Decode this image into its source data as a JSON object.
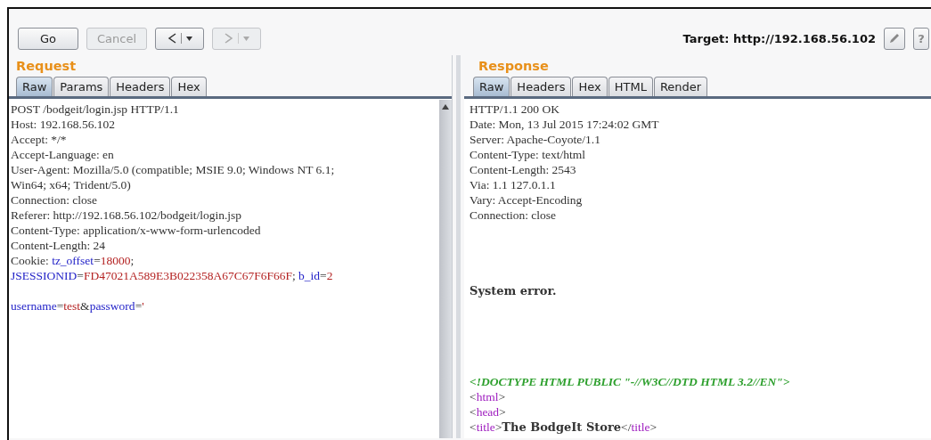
{
  "toolbar": {
    "buttons": [
      {
        "label": "Go",
        "disabled": false
      },
      {
        "label": "Cancel",
        "disabled": true
      }
    ],
    "nav": [
      {
        "kind": "back",
        "disabled": false
      },
      {
        "kind": "forward",
        "disabled": true
      }
    ],
    "target": "Target: http://192.168.56.102",
    "help": "?"
  },
  "request": {
    "title": "Request",
    "tabs": [
      {
        "label": "Raw",
        "selected": true
      },
      {
        "label": "Params",
        "selected": false
      },
      {
        "label": "Headers",
        "selected": false
      },
      {
        "label": "Hex",
        "selected": false
      }
    ],
    "lines": [
      {
        "kind": "text",
        "tokens": [
          {
            "kind": "plain",
            "text": "POST /bodgeit/login.jsp HTTP/1.1"
          }
        ]
      },
      {
        "kind": "text",
        "tokens": [
          {
            "kind": "plain",
            "text": "Host: 192.168.56.102"
          }
        ]
      },
      {
        "kind": "text",
        "tokens": [
          {
            "kind": "plain",
            "text": "Accept: */*"
          }
        ]
      },
      {
        "kind": "text",
        "tokens": [
          {
            "kind": "plain",
            "text": "Accept-Language: en"
          }
        ]
      },
      {
        "kind": "text",
        "tokens": [
          {
            "kind": "plain",
            "text": "User-Agent: Mozilla/5.0 (compatible; MSIE 9.0; Windows NT 6.1;"
          }
        ]
      },
      {
        "kind": "text",
        "tokens": [
          {
            "kind": "plain",
            "text": "Win64; x64; Trident/5.0)"
          }
        ]
      },
      {
        "kind": "text",
        "tokens": [
          {
            "kind": "plain",
            "text": "Connection: close"
          }
        ]
      },
      {
        "kind": "text",
        "tokens": [
          {
            "kind": "plain",
            "text": "Referer: http://192.168.56.102/bodgeit/login.jsp"
          }
        ]
      },
      {
        "kind": "text",
        "tokens": [
          {
            "kind": "plain",
            "text": "Content-Type: application/x-www-form-urlencoded"
          }
        ]
      },
      {
        "kind": "text",
        "tokens": [
          {
            "kind": "plain",
            "text": "Content-Length: 24"
          }
        ]
      },
      {
        "kind": "text",
        "tokens": [
          {
            "kind": "plain",
            "text": "Cookie: "
          },
          {
            "kind": "key",
            "text": "tz_offset"
          },
          {
            "kind": "plain",
            "text": "="
          },
          {
            "kind": "value",
            "text": "18000"
          },
          {
            "kind": "plain",
            "text": ";"
          }
        ]
      },
      {
        "kind": "text",
        "tokens": [
          {
            "kind": "key",
            "text": "JSESSIONID"
          },
          {
            "kind": "plain",
            "text": "="
          },
          {
            "kind": "value",
            "text": "FD47021A589E3B022358A67C67F6F66F"
          },
          {
            "kind": "plain",
            "text": "; "
          },
          {
            "kind": "key",
            "text": "b_id"
          },
          {
            "kind": "plain",
            "text": "="
          },
          {
            "kind": "value",
            "text": "2"
          }
        ]
      },
      {
        "kind": "blank"
      },
      {
        "kind": "text",
        "tokens": [
          {
            "kind": "key",
            "text": "username"
          },
          {
            "kind": "plain",
            "text": "="
          },
          {
            "kind": "value",
            "text": "test"
          },
          {
            "kind": "plain",
            "text": "&"
          },
          {
            "kind": "key",
            "text": "password"
          },
          {
            "kind": "plain",
            "text": "="
          },
          {
            "kind": "value",
            "text": "'"
          }
        ]
      }
    ]
  },
  "response": {
    "title": "Response",
    "tabs": [
      {
        "label": "Raw",
        "selected": true
      },
      {
        "label": "Headers",
        "selected": false
      },
      {
        "label": "Hex",
        "selected": false
      },
      {
        "label": "HTML",
        "selected": false
      },
      {
        "label": "Render",
        "selected": false
      }
    ],
    "lines": [
      {
        "kind": "text",
        "tokens": [
          {
            "kind": "plain",
            "text": "HTTP/1.1 200 OK"
          }
        ]
      },
      {
        "kind": "text",
        "tokens": [
          {
            "kind": "plain",
            "text": "Date: Mon, 13 Jul 2015 17:24:02 GMT"
          }
        ]
      },
      {
        "kind": "text",
        "tokens": [
          {
            "kind": "plain",
            "text": "Server: Apache-Coyote/1.1"
          }
        ]
      },
      {
        "kind": "text",
        "tokens": [
          {
            "kind": "plain",
            "text": "Content-Type: text/html"
          }
        ]
      },
      {
        "kind": "text",
        "tokens": [
          {
            "kind": "plain",
            "text": "Content-Length: 2543"
          }
        ]
      },
      {
        "kind": "text",
        "tokens": [
          {
            "kind": "plain",
            "text": "Via: 1.1 127.0.1.1"
          }
        ]
      },
      {
        "kind": "text",
        "tokens": [
          {
            "kind": "plain",
            "text": "Vary: Accept-Encoding"
          }
        ]
      },
      {
        "kind": "text",
        "tokens": [
          {
            "kind": "plain",
            "text": "Connection: close"
          }
        ]
      },
      {
        "kind": "blank"
      },
      {
        "kind": "blank"
      },
      {
        "kind": "blank"
      },
      {
        "kind": "blank"
      },
      {
        "kind": "text",
        "tokens": [
          {
            "kind": "bold",
            "text": "System error."
          }
        ]
      },
      {
        "kind": "blank"
      },
      {
        "kind": "blank"
      },
      {
        "kind": "blank"
      },
      {
        "kind": "blank"
      },
      {
        "kind": "blank"
      },
      {
        "kind": "text",
        "tokens": [
          {
            "kind": "comment",
            "text": "<!DOCTYPE HTML PUBLIC \"-//W3C//DTD HTML 3.2//EN\">"
          }
        ]
      },
      {
        "kind": "text",
        "tokens": [
          {
            "kind": "plain",
            "text": "<"
          },
          {
            "kind": "tag",
            "text": "html"
          },
          {
            "kind": "plain",
            "text": ">"
          }
        ]
      },
      {
        "kind": "text",
        "tokens": [
          {
            "kind": "plain",
            "text": "<"
          },
          {
            "kind": "tag",
            "text": "head"
          },
          {
            "kind": "plain",
            "text": ">"
          }
        ]
      },
      {
        "kind": "text",
        "tokens": [
          {
            "kind": "plain",
            "text": "<"
          },
          {
            "kind": "tag",
            "text": "title"
          },
          {
            "kind": "plain",
            "text": ">"
          },
          {
            "kind": "bold",
            "text": "The BodgeIt Store"
          },
          {
            "kind": "plain",
            "text": "</"
          },
          {
            "kind": "tag",
            "text": "title"
          },
          {
            "kind": "plain",
            "text": ">"
          }
        ]
      }
    ]
  }
}
